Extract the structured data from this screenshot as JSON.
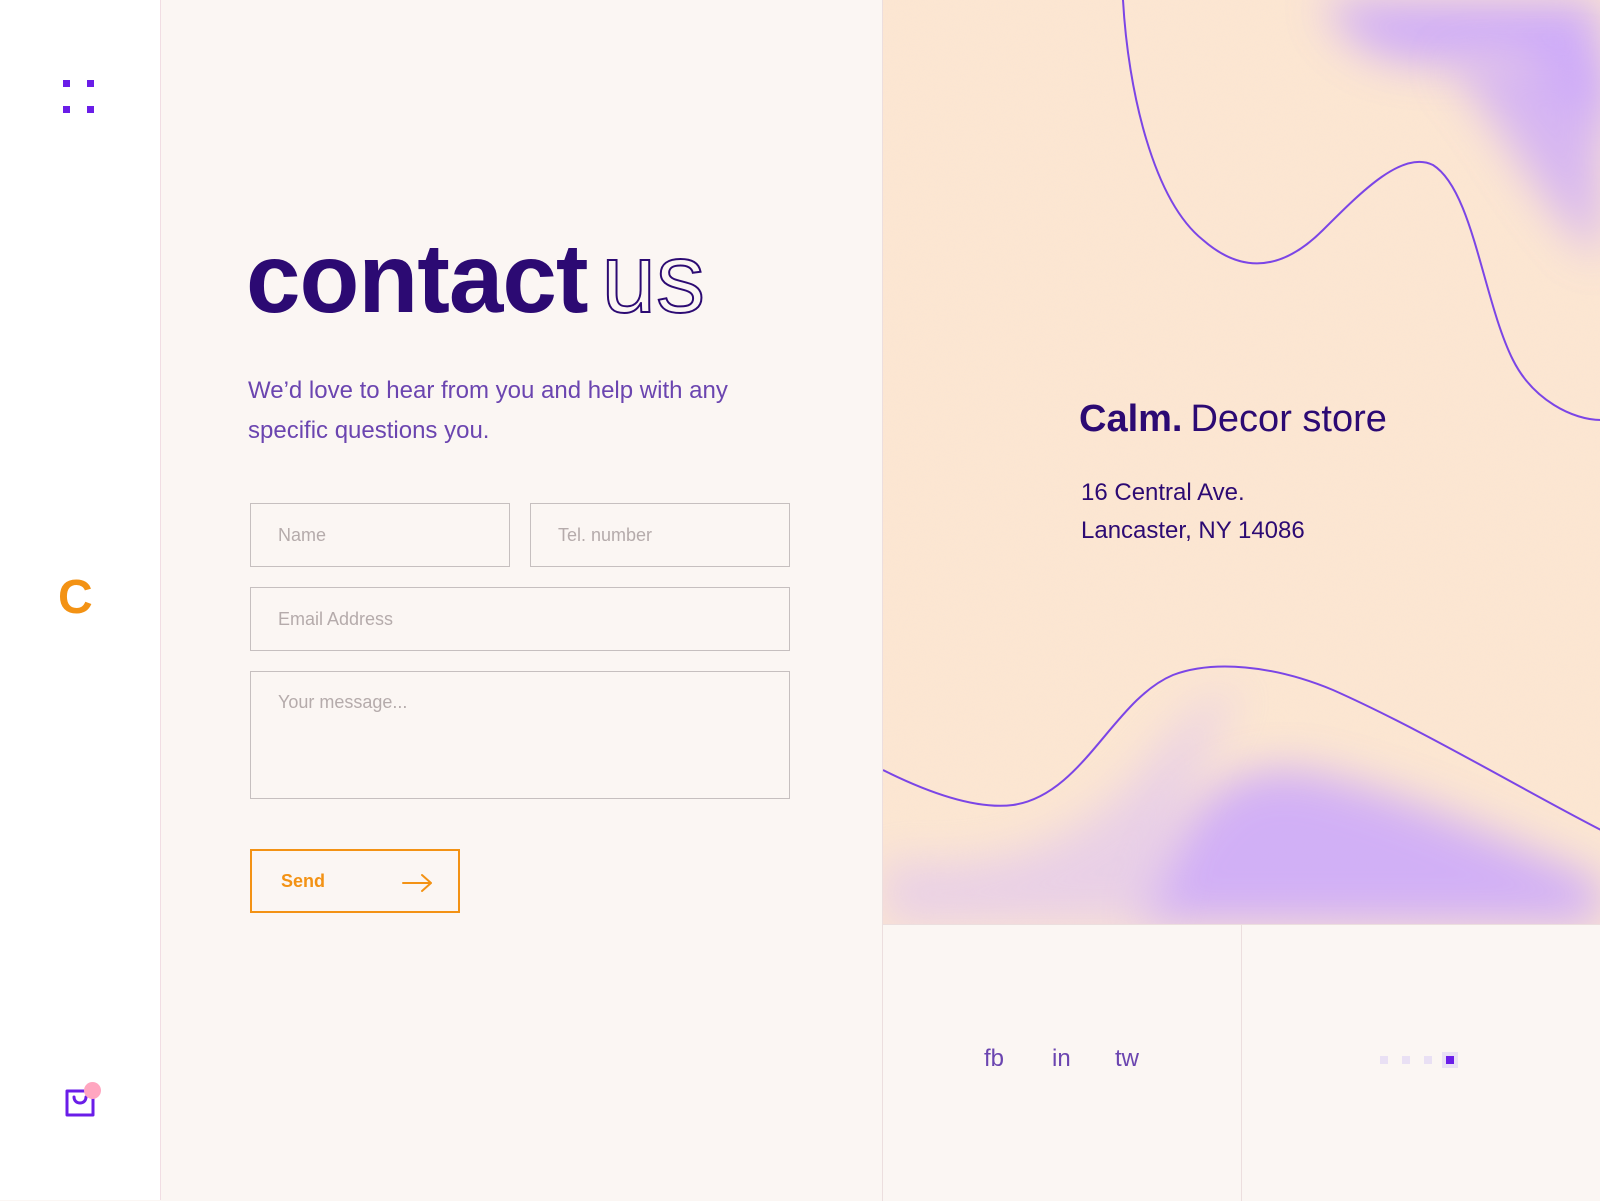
{
  "sidebar": {
    "menu_icon": "grid-dots-icon",
    "logo": "C",
    "cart_icon": "shopping-bag-icon"
  },
  "hero": {
    "title_bold": "contact",
    "title_outline": "us",
    "subtitle": "We’d love to hear from you and help with any specific questions you."
  },
  "form": {
    "name_placeholder": "Name",
    "tel_placeholder": "Tel. number",
    "email_placeholder": "Email Address",
    "message_placeholder": "Your message...",
    "send_label": "Send",
    "send_icon": "arrow-right-icon"
  },
  "store": {
    "name_bold": "Calm.",
    "name_light": "Decor store",
    "address_line1": "16 Central Ave.",
    "address_line2": "Lancaster, NY 14086"
  },
  "social": {
    "fb": "fb",
    "in": "in",
    "tw": "tw"
  },
  "pagination": {
    "total": 4,
    "active": 4
  },
  "colors": {
    "brand_dark": "#2c0a73",
    "accent_orange": "#f39214",
    "accent_purple": "#6a1de8",
    "panel_peach": "#fde7cf",
    "wave_lavender": "#c7a3ff",
    "background": "#fbf6f3",
    "cart_badge": "#ffa6c0"
  }
}
